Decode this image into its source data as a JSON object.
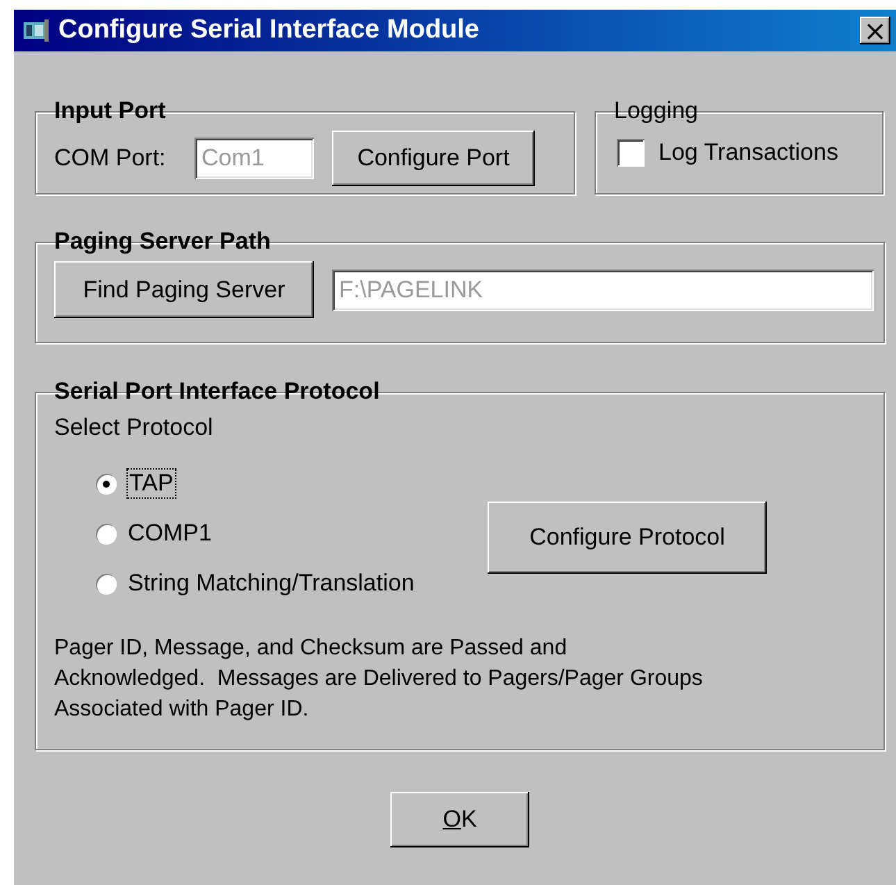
{
  "window": {
    "title": "Configure Serial Interface Module",
    "close": "×"
  },
  "input_port": {
    "title": "Input Port",
    "label": "COM Port:",
    "value": "Com1",
    "disabled": true,
    "button": "Configure Port"
  },
  "logging": {
    "title": "Logging",
    "checkbox": {
      "label": "Log Transactions",
      "checked": false
    }
  },
  "paging_server_path": {
    "title": "Paging Server Path",
    "button": "Find Paging Server",
    "value": "F:\\PAGELINK",
    "disabled": true
  },
  "protocol": {
    "title": "Serial Port Interface Protocol",
    "label": "Select Protocol",
    "options": [
      {
        "label": "TAP",
        "selected": true
      },
      {
        "label": "COMP1",
        "selected": false
      },
      {
        "label": "String Matching/Translation",
        "selected": false
      }
    ],
    "button": "Configure Protocol",
    "description": "Pager ID, Message, and Checksum are Passed and Acknowledged.  Messages are Delivered to Pagers/Pager Groups Associated with Pager ID."
  },
  "ok_button": {
    "label": "OK",
    "mnemonic_underlined": true
  }
}
